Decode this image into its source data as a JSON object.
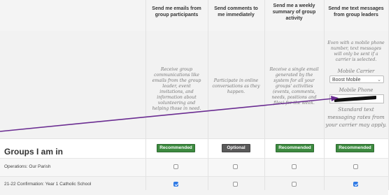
{
  "columns": [
    {
      "header": "Send me emails from group participants",
      "description": "Receive group communications like emails from the group leader, event invitations, and information about volunteering and helping those in need.",
      "badge": "Recommended"
    },
    {
      "header": "Send comments to me immediately",
      "description": "Participate in online conversations as they happen.",
      "badge": "Optional"
    },
    {
      "header": "Send me a weekly summary of group activity",
      "description": "Receive a single email generated by the system for all your groups' activities (events, comments, needs, positions and files) for the week.",
      "badge": "Recommended"
    },
    {
      "header": "Send me text messages from group leaders",
      "sms_intro": "Even with a mobile phone number, text messages will only be sent if a carrier is selected.",
      "carrier_label": "Mobile Carrier",
      "carrier_value": "Boost Mobile",
      "phone_label": "Mobile Phone",
      "sms_note": "Standard text messaging rates from your carrier may apply.",
      "badge": "Recommended"
    }
  ],
  "groups_title": "Groups I am in",
  "groups": [
    {
      "name": "Operations: Our Parish",
      "checks": [
        false,
        false,
        false,
        false
      ]
    },
    {
      "name": "21-22 Confirmation: Year 1 Catholic School",
      "checks": [
        true,
        false,
        false,
        true
      ]
    }
  ],
  "colors": {
    "recommended": "#3c8a3f",
    "optional": "#5a5a5a",
    "checkbox_checked": "#2f7ae5",
    "arrow": "#6a2c91"
  }
}
